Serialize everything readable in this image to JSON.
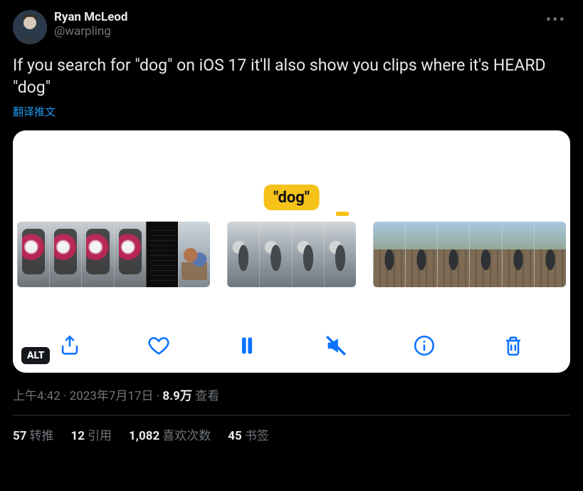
{
  "author": {
    "display_name": "Ryan McLeod",
    "handle": "@warpling"
  },
  "tweet_text": "If you search for \"dog\" on iOS 17 it'll also show you clips where it's HEARD \"dog\"",
  "translate_label": "翻译推文",
  "media": {
    "search_label": "\"dog\"",
    "alt_badge": "ALT",
    "toolbar_icons": [
      "share",
      "heart",
      "pause",
      "mute",
      "info",
      "trash"
    ]
  },
  "meta": {
    "time": "上午4:42",
    "separator1": " · ",
    "date": "2023年7月17日",
    "separator2": " · ",
    "views_count": "8.9万",
    "views_label": " 查看"
  },
  "stats": {
    "retweets_count": "57",
    "retweets_label": "转推",
    "quotes_count": "12",
    "quotes_label": "引用",
    "likes_count": "1,082",
    "likes_label": "喜欢次数",
    "bookmarks_count": "45",
    "bookmarks_label": "书签"
  }
}
